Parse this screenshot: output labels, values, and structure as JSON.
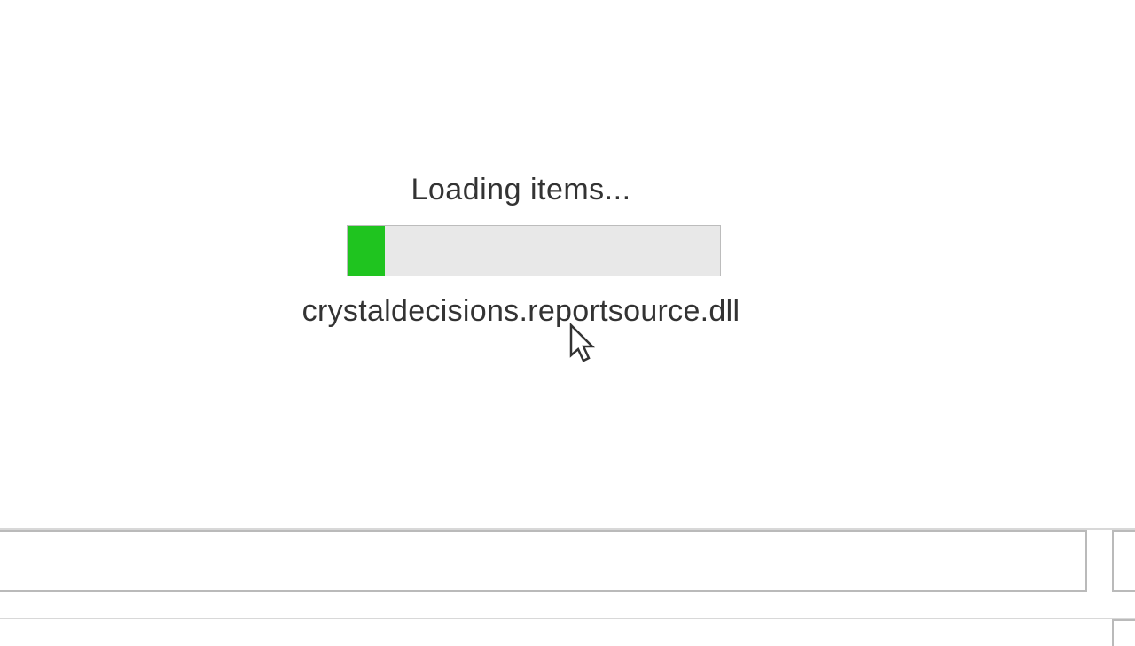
{
  "loading": {
    "title": "Loading items...",
    "current_file": "crystaldecisions.reportsource.dll",
    "progress_percent": 10
  },
  "colors": {
    "progress_fill": "#1fc41f",
    "progress_track": "#e8e8e8",
    "border": "#bcbcbc"
  }
}
